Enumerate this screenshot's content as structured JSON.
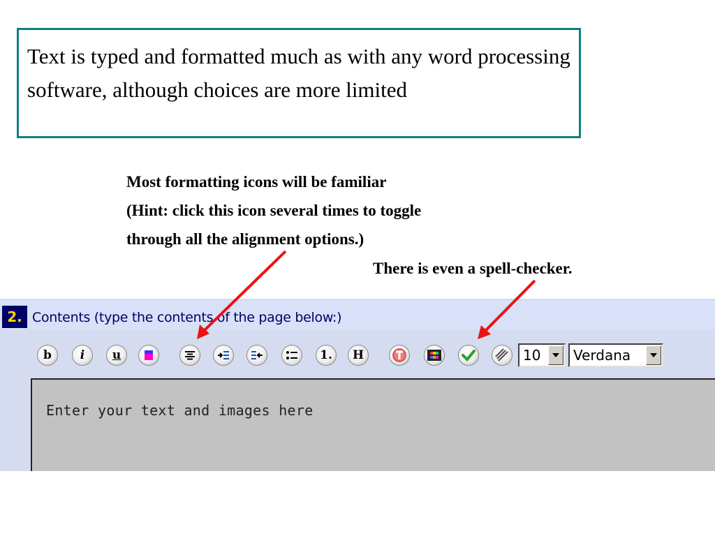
{
  "callout": {
    "text": "Text is typed and formatted much as with any word processing software, although choices are more limited"
  },
  "notes": {
    "formatting_line1": "Most formatting icons will be familiar",
    "formatting_line2": "(Hint: click this icon several times to toggle",
    "formatting_line3": "through all the alignment options.)",
    "spell_checker": "There is even a spell-checker."
  },
  "section": {
    "number": "2.",
    "title": "Contents (type the contents of the page below:)"
  },
  "toolbar": {
    "bold_label": "b",
    "italic_label": "i",
    "underline_label": "u",
    "ordered_list_label": "1.",
    "heading_label": "H",
    "font_size": "10",
    "font_family": "Verdana",
    "icons": [
      "bold-icon",
      "italic-icon",
      "underline-icon",
      "text-color-icon",
      "align-center-icon",
      "indent-icon",
      "outdent-icon",
      "bullet-list-icon",
      "numbered-list-icon",
      "heading-icon",
      "clear-format-icon",
      "insert-media-icon",
      "spell-check-icon",
      "insert-link-icon"
    ]
  },
  "editor": {
    "placeholder": "Enter your text and images here"
  },
  "colors": {
    "callout_border": "#0f7f80",
    "arrow": "#ee1111",
    "section_number_bg": "#000066",
    "section_number_fg": "#ffd400"
  }
}
